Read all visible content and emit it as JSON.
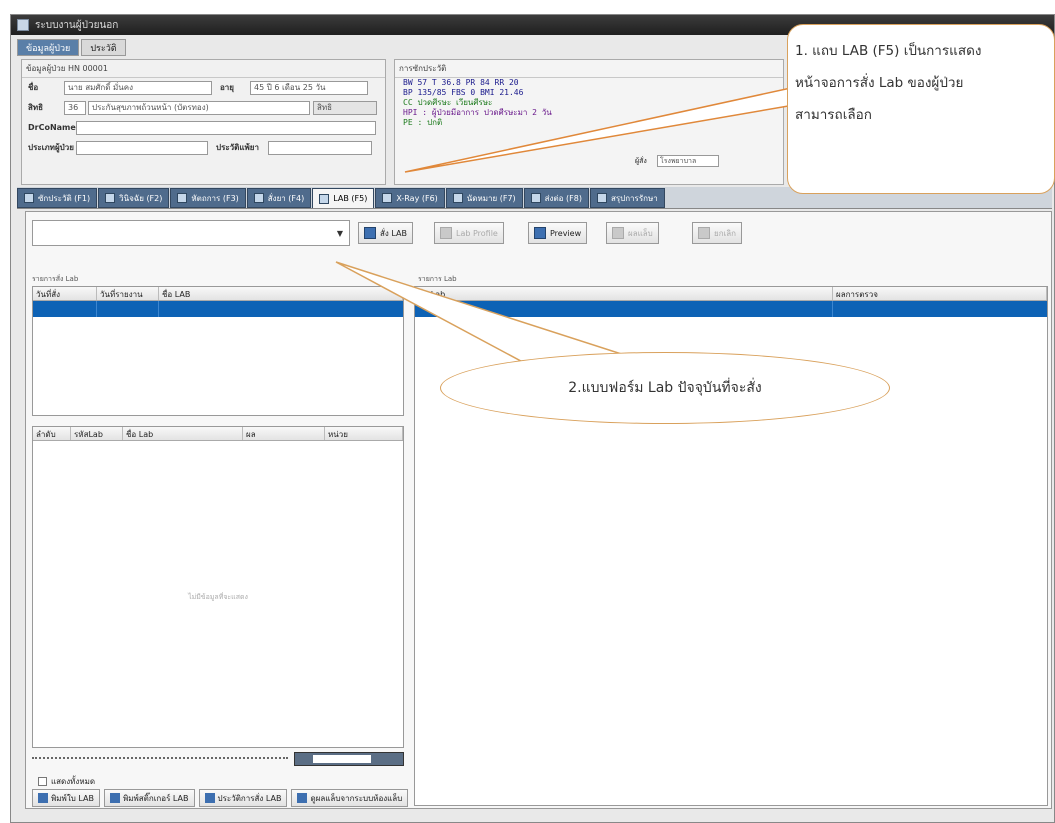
{
  "window": {
    "title": "ระบบงานผู้ป่วยนอก"
  },
  "patient_tabs": [
    {
      "label": "ข้อมูลผู้ป่วย"
    },
    {
      "label": "ประวัติ"
    }
  ],
  "patient": {
    "header": "ข้อมูลผู้ป่วย HN 00001",
    "name_label": "ชื่อ",
    "name": "นาย สมศักดิ์ มั่นคง",
    "age_label": "อายุ",
    "age": "45 ปี 6 เดือน 25 วัน",
    "right_label": "สิทธิ",
    "right_code": "36",
    "right_name": "ประกันสุขภาพถ้วนหน้า (บัตรทอง)",
    "right_button": "สิทธิ",
    "doctor_label": "DrCoName",
    "address_label": "ประเภทผู้ป่วย",
    "allergy_label": "ประวัติแพ้ยา"
  },
  "vitals": {
    "header": "การซักประวัติ",
    "line1": "BW 57    T 36.8   PR 84    RR 20",
    "line2": "BP 135/85   FBS 0       BMI 21.46",
    "line3": "CC  ปวดศีรษะ เวียนศีรษะ",
    "line4": "HPI : ผู้ป่วยมีอาการ ปวดศีรษะมา 2 วัน",
    "line5": "PE : ปกติ",
    "clinic_label": "ผู้สั่ง",
    "clinic_value": "โรงพยาบาล"
  },
  "main_tabs": [
    {
      "label": "ซักประวัติ (F1)"
    },
    {
      "label": "วินิจฉัย (F2)"
    },
    {
      "label": "หัตถการ (F3)"
    },
    {
      "label": "สั่งยา (F4)"
    },
    {
      "label": "LAB (F5)"
    },
    {
      "label": "X-Ray (F6)"
    },
    {
      "label": "นัดหมาย (F7)"
    },
    {
      "label": "ส่งต่อ (F8)"
    },
    {
      "label": "สรุปการรักษา"
    }
  ],
  "toolbar": {
    "combo_value": "",
    "buttons": [
      {
        "label": "สั่ง LAB",
        "disabled": false
      },
      {
        "label": "Lab Profile",
        "disabled": true
      },
      {
        "label": "Preview",
        "disabled": false
      },
      {
        "label": "ผลแล็บ",
        "disabled": true
      },
      {
        "label": "ยกเลิก",
        "disabled": true
      }
    ]
  },
  "left_top_grid": {
    "title": "รายการสั่ง Lab",
    "columns": [
      "วันที่สั่ง",
      "วันที่รายงาน",
      "ชื่อ LAB"
    ]
  },
  "left_bottom_grid": {
    "columns": [
      "ลำดับ",
      "รหัสLab",
      "ชื่อ Lab",
      "ผล",
      "หน่วย"
    ],
    "empty_text": "ไม่มีข้อมูลที่จะแสดง"
  },
  "right_grid": {
    "title": "รายการ Lab",
    "columns": [
      "ชื่อ Lab",
      "ผลการตรวจ"
    ]
  },
  "checkbox": {
    "label": "แสดงทั้งหมด"
  },
  "bottom_buttons": [
    {
      "label": "พิมพ์ใบ LAB"
    },
    {
      "label": "พิมพ์สติ๊กเกอร์ LAB"
    },
    {
      "label": "ประวัติการสั่ง LAB"
    },
    {
      "label": "ดูผลแล็บจากระบบห้องแล็บ"
    }
  ],
  "callouts": {
    "one": {
      "line1": "1. แถบ LAB (F5) เป็นการแสดง",
      "line2": "หน้าจอการสั่ง Lab ของผู้ป่วย",
      "line3": "สามารถเลือก"
    },
    "two": {
      "text": "2.แบบฟอร์ม Lab ปัจจุบันที่จะสั่ง"
    }
  }
}
